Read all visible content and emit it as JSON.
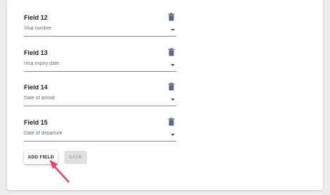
{
  "fields": [
    {
      "title": "Field 12",
      "value": "Visa number"
    },
    {
      "title": "Field 13",
      "value": "Visa expiry date"
    },
    {
      "title": "Field 14",
      "value": "Date of arrival"
    },
    {
      "title": "Field 15",
      "value": "Date of departure"
    }
  ],
  "actions": {
    "add_label": "ADD FIELD",
    "save_label": "SAVE"
  },
  "icons": {
    "delete": "trash-icon",
    "dropdown": "chevron-down-icon",
    "pointer": "arrow-pointer-icon"
  },
  "colors": {
    "pointer": "#ee3d7a",
    "trash": "#5f6b7a"
  }
}
